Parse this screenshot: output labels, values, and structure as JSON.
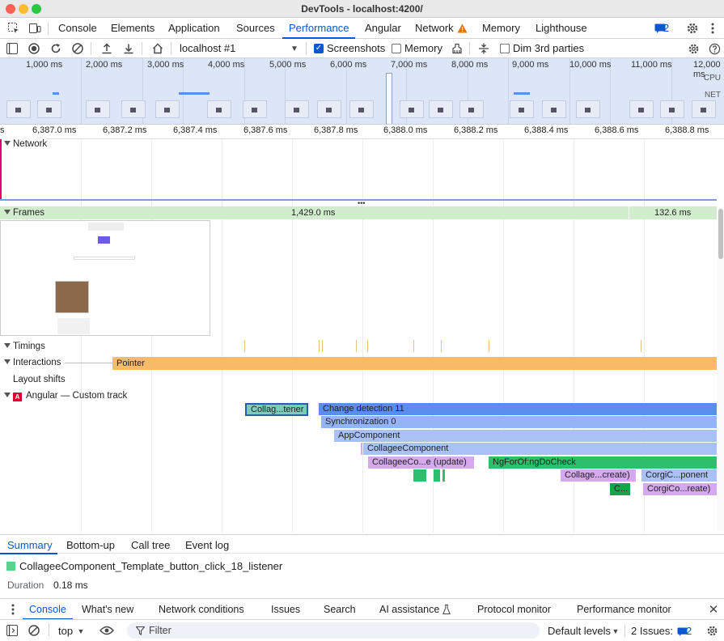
{
  "window": {
    "title": "DevTools - localhost:4200/"
  },
  "tabs": [
    {
      "label": "Console"
    },
    {
      "label": "Elements"
    },
    {
      "label": "Application"
    },
    {
      "label": "Sources"
    },
    {
      "label": "Performance"
    },
    {
      "label": "Angular"
    },
    {
      "label": "Network"
    },
    {
      "label": "Memory"
    },
    {
      "label": "Lighthouse"
    }
  ],
  "active_tab": "Performance",
  "issues_badge": "2",
  "toolbar": {
    "target": "localhost #1",
    "screenshots_label": "Screenshots",
    "screenshots_checked": true,
    "memory_label": "Memory",
    "memory_checked": false,
    "dim_label": "Dim 3rd parties",
    "dim_checked": false
  },
  "overview": {
    "ticks": [
      "1,000 ms",
      "2,000 ms",
      "3,000 ms",
      "4,000 ms",
      "5,000 ms",
      "6,000 ms",
      "7,000 ms",
      "8,000 ms",
      "9,000 ms",
      "10,000 ms",
      "11,000 ms",
      "12,000 ms"
    ],
    "cpu_label": "CPU",
    "net_label": "NET"
  },
  "ruler": {
    "first": "s",
    "ticks": [
      "6,387.0 ms",
      "6,387.2 ms",
      "6,387.4 ms",
      "6,387.6 ms",
      "6,387.8 ms",
      "6,388.0 ms",
      "6,388.2 ms",
      "6,388.4 ms",
      "6,388.6 ms",
      "6,388.8 ms"
    ]
  },
  "tracks": {
    "network": "Network",
    "frames": "Frames",
    "frames_duration_1": "1,429.0 ms",
    "frames_duration_2": "132.6 ms",
    "timings": "Timings",
    "interactions": "Interactions",
    "pointer": "Pointer",
    "layout_shifts": "Layout shifts",
    "angular_badge": "A",
    "angular": "Angular — Custom track"
  },
  "flame": {
    "listener": "Collag...tener",
    "change_detection": "Change detection 11",
    "synchronization": "Synchronization 0",
    "app_component": "AppComponent",
    "collagee_component": "CollageeComponent",
    "collagee_update": "CollageeCo...e (update)",
    "ngforof": "NgForOf:ngDoCheck",
    "collagee_create": "Collage...create)",
    "corgi_component": "CorgiC...ponent",
    "c_short": "C...",
    "corgi_create": "CorgiCo...reate)"
  },
  "bottom_tabs": [
    {
      "label": "Summary"
    },
    {
      "label": "Bottom-up"
    },
    {
      "label": "Call tree"
    },
    {
      "label": "Event log"
    }
  ],
  "summary": {
    "title": "CollageeComponent_Template_button_click_18_listener",
    "duration_label": "Duration",
    "duration_value": "0.18 ms"
  },
  "drawer_tabs": [
    {
      "label": "Console"
    },
    {
      "label": "What's new"
    },
    {
      "label": "Network conditions"
    },
    {
      "label": "Issues"
    },
    {
      "label": "Search"
    },
    {
      "label": "AI assistance"
    },
    {
      "label": "Protocol monitor"
    },
    {
      "label": "Performance monitor"
    }
  ],
  "console_bar": {
    "context": "top",
    "filter_placeholder": "Filter",
    "levels": "Default levels",
    "issues_label": "2 Issues:",
    "issues_count": "2"
  },
  "colors": {
    "accent": "#0b57d0",
    "frames": "#d1edcd",
    "interaction": "#f9bb6a",
    "change_detection": "#5b8def",
    "sync": "#a9c1f5",
    "template": "#d6a8f0",
    "ngdocheck": "#2dbf6b"
  }
}
